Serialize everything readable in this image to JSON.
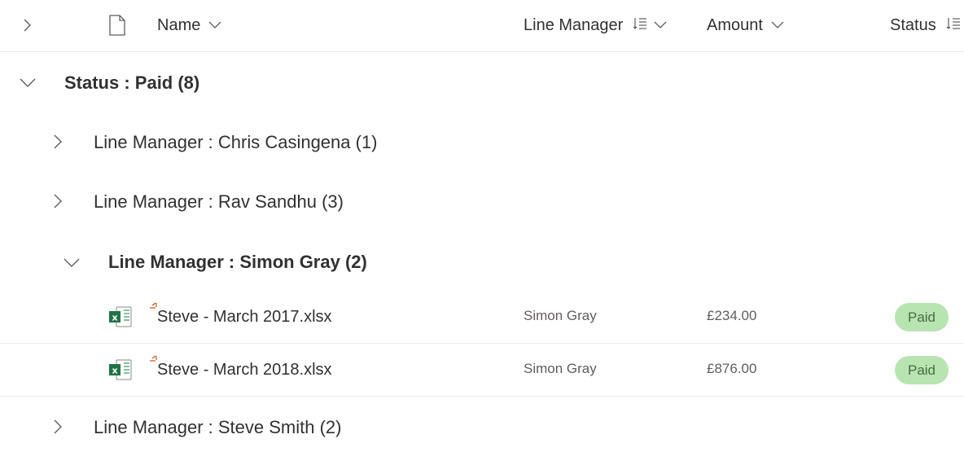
{
  "header": {
    "expand_all_icon": "chevron-right-icon",
    "file_type_icon": "document-icon",
    "columns": {
      "name": "Name",
      "line_manager": "Line Manager",
      "amount": "Amount",
      "status": "Status"
    }
  },
  "groups": {
    "status_paid": {
      "label": "Status : Paid (8)",
      "expanded": true
    },
    "chris": {
      "label": "Line Manager : Chris Casingena (1)",
      "expanded": false
    },
    "rav": {
      "label": "Line Manager : Rav Sandhu (3)",
      "expanded": false
    },
    "simon": {
      "label": "Line Manager : Simon Gray (2)",
      "expanded": true
    },
    "steve": {
      "label": "Line Manager : Steve Smith (2)",
      "expanded": false
    }
  },
  "rows": [
    {
      "name": "Steve - March 2017.xlsx",
      "line_manager": "Simon Gray",
      "amount": "£234.00",
      "status": "Paid",
      "icon": "excel-file-icon",
      "new_indicator": "new-item-icon"
    },
    {
      "name": "Steve - March 2018.xlsx",
      "line_manager": "Simon Gray",
      "amount": "£876.00",
      "status": "Paid",
      "icon": "excel-file-icon",
      "new_indicator": "new-item-icon"
    }
  ],
  "colors": {
    "status_paid_bg": "#b7e4b0",
    "status_paid_text": "#4a6b45",
    "excel_green": "#217346",
    "new_indicator": "#ca5010",
    "divider": "#edebe9"
  }
}
